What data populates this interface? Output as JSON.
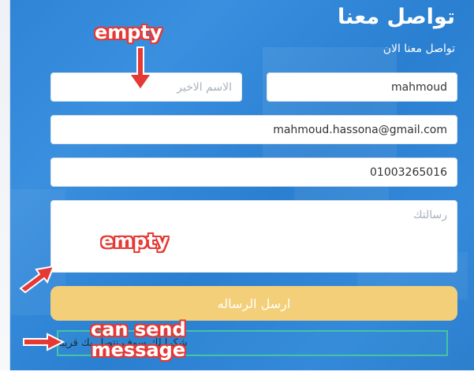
{
  "contact": {
    "title": "تواصل معنا",
    "subtitle": "تواصل معنا الان",
    "first_name_value": "mahmoud",
    "last_name_placeholder": "الاسم الاخير",
    "email_value": "mahmoud.hassona@gmail.com",
    "phone_value": "01003265016",
    "message_placeholder": "رسالتك",
    "send_label": "ارسل الرساله",
    "success_text": "شكرا لك سوف نتصل بك قريبا"
  },
  "annotations": {
    "empty_top": "empty",
    "empty_message": "empty",
    "can_send_line1": "can send",
    "can_send_line2": "message"
  },
  "colors": {
    "panel": "#2f84d6",
    "button": "#f3cf79",
    "success_border": "#46c3a2",
    "annotation": "#e53935"
  }
}
